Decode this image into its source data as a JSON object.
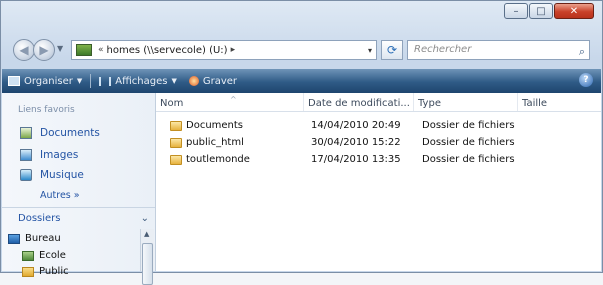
{
  "window": {
    "caption_buttons": {
      "minimize": "–",
      "maximize": "□",
      "close": "✕"
    }
  },
  "address": {
    "back_icon": "back-arrow-icon",
    "forward_icon": "forward-arrow-icon",
    "prefix_arrows": "«",
    "path": "homes (\\\\servecole) (U:)",
    "path_arrow": "▸",
    "dropdown": "▾",
    "refresh_glyph": "⟳",
    "search_placeholder": "Rechercher",
    "search_glyph": "⌕"
  },
  "toolbar": {
    "organize": "Organiser",
    "views": "Affichages",
    "burn": "Graver",
    "help": "?"
  },
  "nav": {
    "favorites_title": "Liens favoris",
    "favorites": [
      {
        "label": "Documents",
        "icon": "documents-icon"
      },
      {
        "label": "Images",
        "icon": "pictures-icon"
      },
      {
        "label": "Musique",
        "icon": "music-icon"
      }
    ],
    "more": "Autres »",
    "folders_title": "Dossiers",
    "folders_chevron": "⌄",
    "tree": [
      {
        "label": "Bureau",
        "icon": "desktop-icon"
      },
      {
        "label": "Ecole",
        "icon": "user-folder-icon"
      },
      {
        "label": "Public",
        "icon": "folder-icon"
      }
    ]
  },
  "content": {
    "columns": [
      "Nom",
      "Date de modificati...",
      "Type",
      "Taille"
    ],
    "rows": [
      {
        "name": "Documents",
        "date": "14/04/2010 20:49",
        "type": "Dossier de fichiers",
        "size": ""
      },
      {
        "name": "public_html",
        "date": "30/04/2010 15:22",
        "type": "Dossier de fichiers",
        "size": ""
      },
      {
        "name": "toutlemonde",
        "date": "17/04/2010 13:35",
        "type": "Dossier de fichiers",
        "size": ""
      }
    ]
  },
  "colors": {
    "toolbar": "#2f5b86",
    "link": "#2454a4",
    "folder": "#e7b23f",
    "close": "#c9412a"
  }
}
